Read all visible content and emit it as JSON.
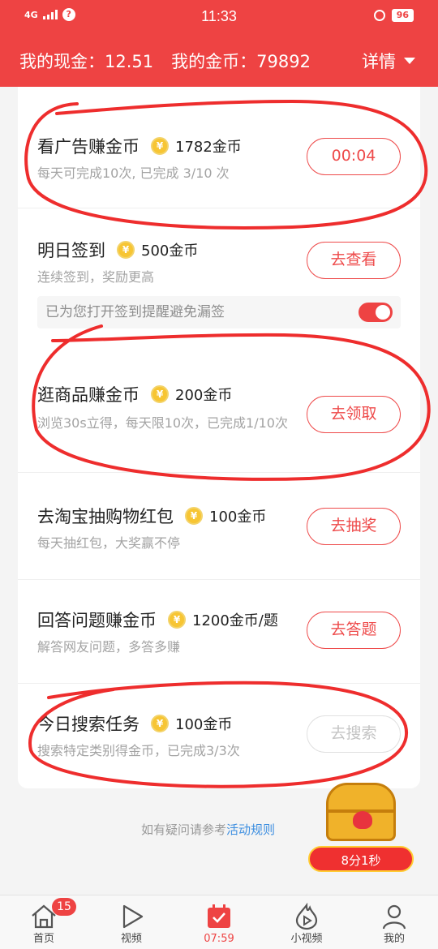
{
  "status_bar": {
    "network": "4G",
    "time": "11:33",
    "battery": "96"
  },
  "header": {
    "cash_label": "我的现金：12.51",
    "coins_label": "我的金币：79892",
    "detail_label": "详情"
  },
  "tasks": [
    {
      "title": "看广告赚金币",
      "reward": "1782金币",
      "desc": "每天可完成10次, 已完成 3/10 次",
      "button": "00:04",
      "enabled": true
    },
    {
      "title": "明日签到",
      "reward": "500金币",
      "desc": "连续签到，奖励更高",
      "button": "去查看",
      "enabled": true
    },
    {
      "title": "逛商品赚金币",
      "reward": "200金币",
      "desc": "浏览30s立得，每天限10次，已完成1/10次",
      "button": "去领取",
      "enabled": true
    },
    {
      "title": "去淘宝抽购物红包",
      "reward": "100金币",
      "desc": "每天抽红包，大奖赢不停",
      "button": "去抽奖",
      "enabled": true
    },
    {
      "title": "回答问题赚金币",
      "reward": "1200金币/题",
      "desc": "解答网友问题，多答多赚",
      "button": "去答题",
      "enabled": true
    },
    {
      "title": "今日搜索任务",
      "reward": "100金币",
      "desc": "搜索特定类别得金币，已完成3/3次",
      "button": "去搜索",
      "enabled": false
    }
  ],
  "reminder": {
    "text": "已为您打开签到提醒避免漏签",
    "toggle_on": true
  },
  "coin_glyph": "¥",
  "rules": {
    "prefix": "如有疑问请参考",
    "link": "活动规则"
  },
  "chest_timer": "8分1秒",
  "nav": [
    {
      "label": "首页",
      "icon": "home-icon",
      "badge": "15"
    },
    {
      "label": "视频",
      "icon": "play-icon"
    },
    {
      "label": "07:59",
      "icon": "calendar-icon",
      "active": true
    },
    {
      "label": "小视频",
      "icon": "flame-play-icon"
    },
    {
      "label": "我的",
      "icon": "user-icon"
    }
  ],
  "colors": {
    "primary": "#ee4343",
    "link": "#3e8fe0",
    "coin": "#f7c533"
  }
}
